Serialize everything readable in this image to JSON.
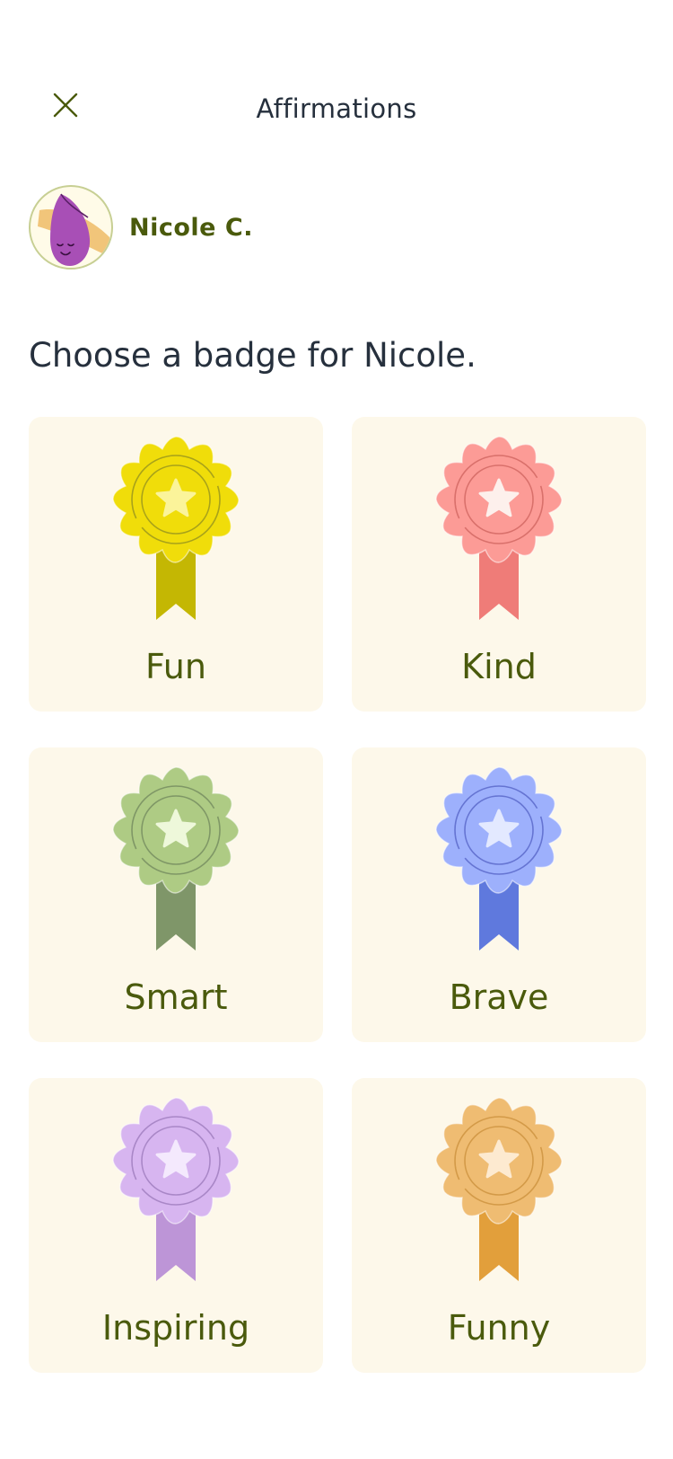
{
  "header": {
    "title": "Affirmations",
    "close_icon": "close-icon"
  },
  "profile": {
    "name": "Nicole C.",
    "avatar_icon": "sweet-potato-avatar"
  },
  "prompt": "Choose a badge for Nicole.",
  "badges": [
    {
      "label": "Fun",
      "icon": "ribbon-badge-icon",
      "colors": {
        "rosette": "#f0dd0a",
        "ring": "#a8a21a",
        "star": "#fbf49a",
        "ribbon": "#c4b703"
      }
    },
    {
      "label": "Kind",
      "icon": "ribbon-badge-icon",
      "colors": {
        "rosette": "#fc9b96",
        "ring": "#d9706b",
        "star": "#fdf0ec",
        "ribbon": "#ef7c78"
      }
    },
    {
      "label": "Smart",
      "icon": "ribbon-badge-icon",
      "colors": {
        "rosette": "#aecb84",
        "ring": "#7f9766",
        "star": "#eef8da",
        "ribbon": "#7f9669"
      }
    },
    {
      "label": "Brave",
      "icon": "ribbon-badge-icon",
      "colors": {
        "rosette": "#9db0fc",
        "ring": "#6574d2",
        "star": "#e3e9ff",
        "ribbon": "#5f79dd"
      }
    },
    {
      "label": "Inspiring",
      "icon": "ribbon-badge-icon",
      "colors": {
        "rosette": "#d7b5f0",
        "ring": "#a987c7",
        "star": "#f4e9fd",
        "ribbon": "#bd95d7"
      }
    },
    {
      "label": "Funny",
      "icon": "ribbon-badge-icon",
      "colors": {
        "rosette": "#efbc72",
        "ring": "#d39a48",
        "star": "#fdead0",
        "ribbon": "#e29f3b"
      }
    }
  ]
}
